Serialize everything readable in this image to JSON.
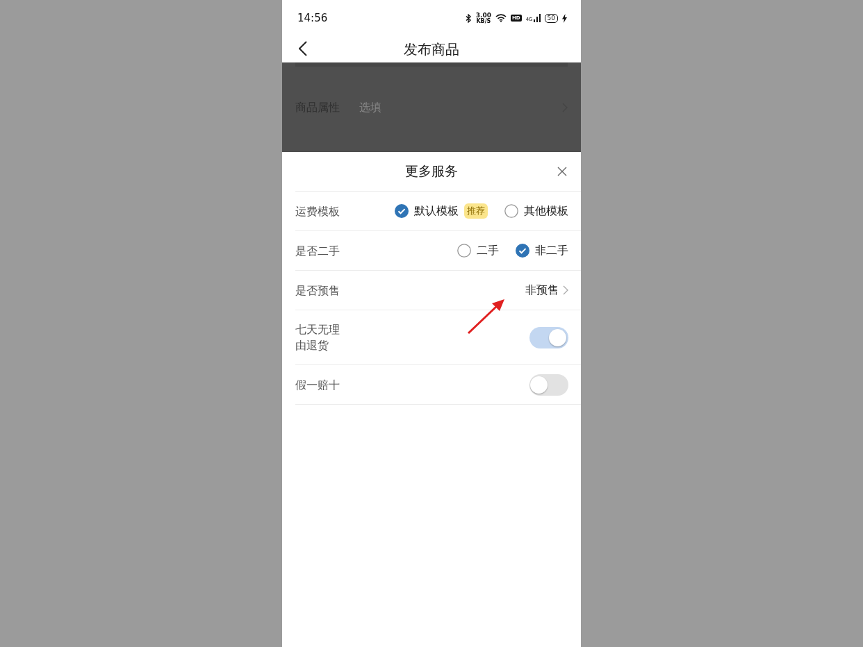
{
  "status_bar": {
    "time": "14:56",
    "net_speed": "3.00",
    "net_unit": "KB/S",
    "hd": "HD",
    "network": "4G",
    "battery": "50"
  },
  "header": {
    "title": "发布商品"
  },
  "background_form": {
    "rows": [
      {
        "label": "商品属性",
        "placeholder": "选填"
      }
    ]
  },
  "sheet": {
    "title": "更多服务",
    "rows": [
      {
        "kind": "radio",
        "label": "运费模板",
        "options": [
          {
            "label": "默认模板",
            "badge": "推荐",
            "selected": true
          },
          {
            "label": "其他模板",
            "selected": false
          }
        ]
      },
      {
        "kind": "radio",
        "label": "是否二手",
        "options": [
          {
            "label": "二手",
            "selected": false
          },
          {
            "label": "非二手",
            "selected": true
          }
        ]
      },
      {
        "kind": "select",
        "label": "是否预售",
        "value": "非预售"
      },
      {
        "kind": "toggle",
        "label": "七天无理由退货",
        "on": true
      },
      {
        "kind": "toggle",
        "label": "假一赔十",
        "on": false
      }
    ]
  }
}
